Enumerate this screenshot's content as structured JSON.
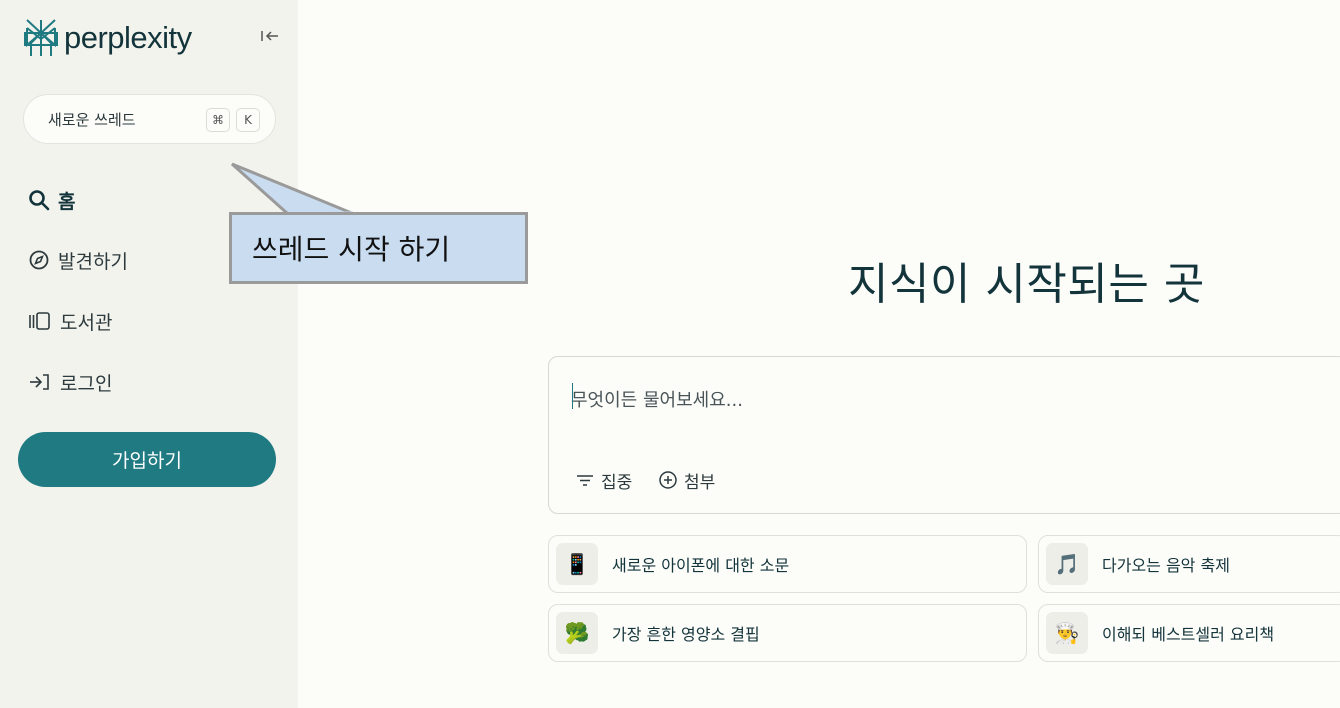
{
  "sidebar": {
    "logo_text": "perplexity",
    "new_thread": {
      "label": "새로운 쓰레드",
      "shortcut_cmd": "⌘",
      "shortcut_key": "K"
    },
    "nav": [
      {
        "label": "홈",
        "icon": "search-icon"
      },
      {
        "label": "발견하기",
        "icon": "compass-icon"
      },
      {
        "label": "도서관",
        "icon": "library-icon"
      },
      {
        "label": "로그인",
        "icon": "login-icon"
      }
    ],
    "signup_label": "가입하기"
  },
  "callout": {
    "text": "쓰레드 시작 하기"
  },
  "main": {
    "title": "지식이 시작되는 곳",
    "search": {
      "placeholder": "무엇이든 물어보세요...",
      "focus_label": "집중",
      "attach_label": "첨부"
    },
    "suggestions": [
      {
        "emoji": "📱",
        "label": "새로운 아이폰에 대한 소문"
      },
      {
        "emoji": "🎵",
        "label": "다가오는 음악 축제"
      },
      {
        "emoji": "🥦",
        "label": "가장 흔한 영양소 결핍"
      },
      {
        "emoji": "👨‍🍳",
        "label": "이해되 베스트셀러 요리책"
      }
    ]
  },
  "colors": {
    "accent": "#1f7a82",
    "sidebar_bg": "#f3f3ee",
    "page_bg": "#fcfcf9",
    "callout_bg": "#c9dcf0"
  }
}
